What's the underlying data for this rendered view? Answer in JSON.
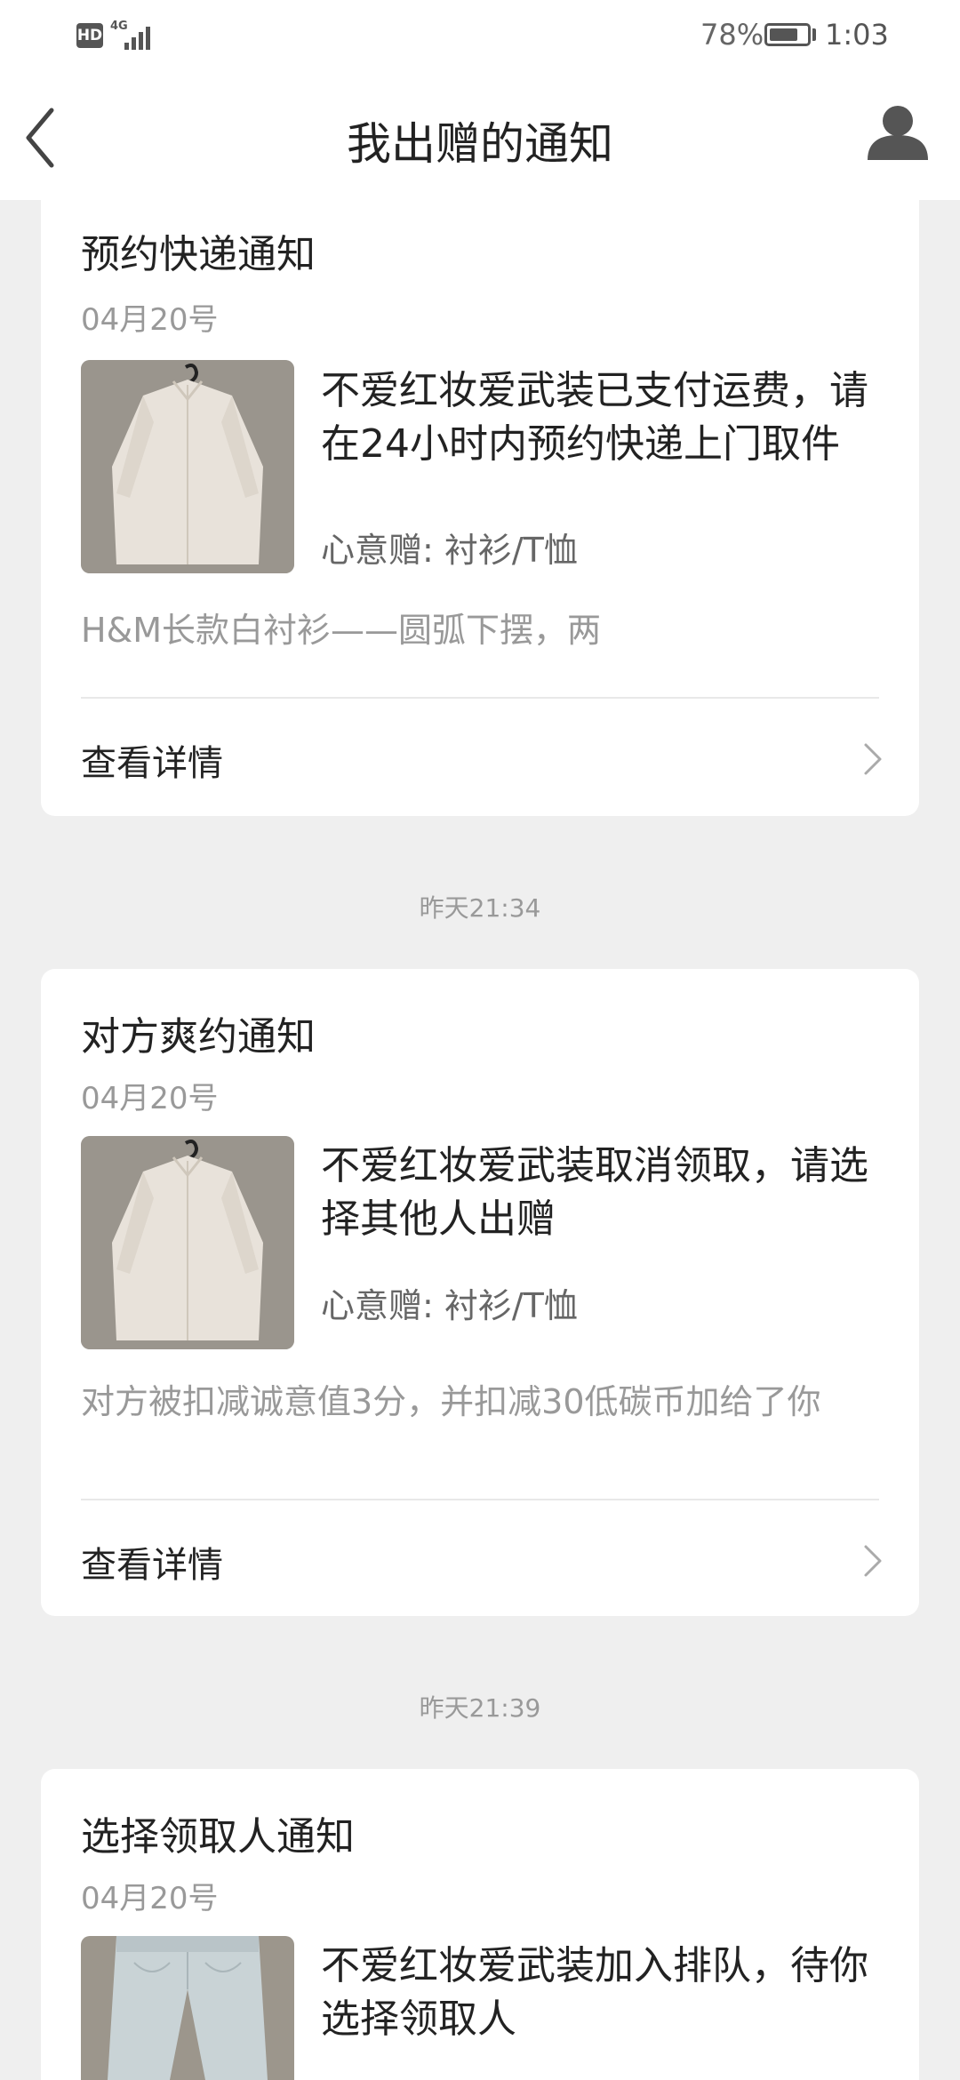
{
  "status_bar": {
    "hd": "HD",
    "network": "4G",
    "battery_percent": "78%",
    "battery_level": 0.78,
    "time": "1:03"
  },
  "header": {
    "title": "我出赠的通知",
    "back_icon": "chevron-left-icon",
    "profile_icon": "user-icon"
  },
  "notifications": [
    {
      "title": "预约快递通知",
      "date": "04月20号",
      "message": "不爱红妆爱武装已支付运费，请在24小时内预约快递上门取件",
      "category": "心意赠: 衬衫/T恤",
      "description": "H&M长款白衬衫——圆弧下摆，两",
      "details_label": "查看详情",
      "thumbnail": "white-shirt"
    },
    {
      "title": "对方爽约通知",
      "date": "04月20号",
      "message": "不爱红妆爱武装取消领取，请选择其他人出赠",
      "category": "心意赠: 衬衫/T恤",
      "description": "对方被扣减诚意值3分，并扣减30低碳币加给了你",
      "details_label": "查看详情",
      "thumbnail": "white-shirt"
    },
    {
      "title": "选择领取人通知",
      "date": "04月20号",
      "message": "不爱红妆爱武装加入排队，待你选择领取人",
      "thumbnail": "jeans"
    }
  ],
  "timestamps": [
    "昨天21:34",
    "昨天21:39"
  ],
  "colors": {
    "background": "#efefef",
    "card": "#ffffff",
    "primary_text": "#222222",
    "secondary_text": "#999999"
  }
}
